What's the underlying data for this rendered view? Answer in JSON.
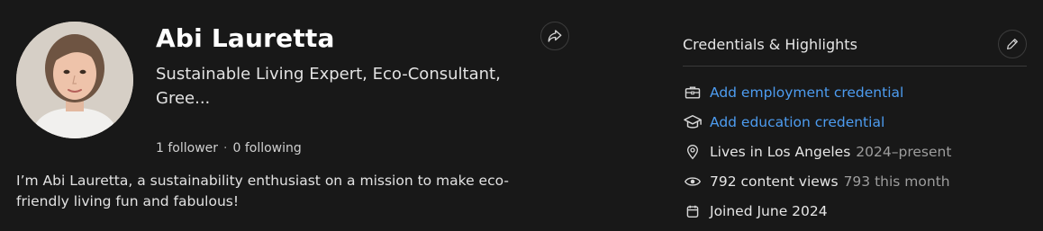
{
  "profile": {
    "name": "Abi Lauretta",
    "tagline": "Sustainable Living Expert, Eco-Consultant, Gree...",
    "followers": "1 follower",
    "separator": "·",
    "following": "0 following",
    "bio": "I’m Abi Lauretta, a sustainability enthusiast on a mission to make eco-friendly living fun and fabulous!"
  },
  "credentials": {
    "title": "Credentials & Highlights",
    "add_employment": "Add employment credential",
    "add_education": "Add education credential",
    "location_label": "Lives in Los Angeles",
    "location_period": "2024–present",
    "views_label": "792 content views",
    "views_month": "793 this month",
    "joined": "Joined June 2024"
  },
  "icons": {
    "share": "share-arrow-icon",
    "edit": "pencil-icon",
    "employment": "briefcase-icon",
    "education": "graduation-cap-icon",
    "location": "map-pin-icon",
    "views": "eye-icon",
    "joined": "calendar-icon"
  },
  "colors": {
    "background": "#181818",
    "link": "#4d9cf0",
    "muted": "#9d9d9d"
  }
}
